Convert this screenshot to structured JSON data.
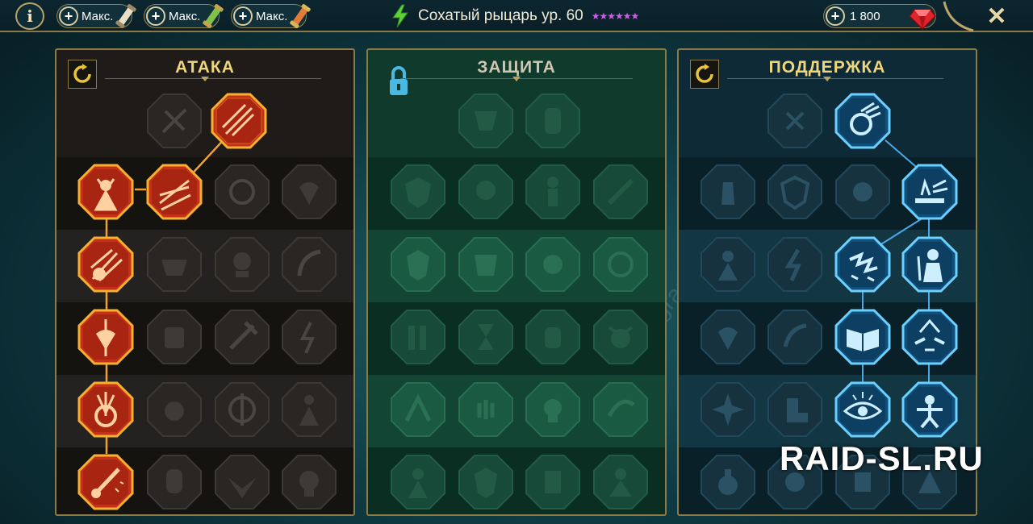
{
  "topbar": {
    "info_label": "i",
    "max_buttons": [
      {
        "label": "Макс."
      },
      {
        "label": "Макс."
      },
      {
        "label": "Макс."
      }
    ],
    "hero_name": "Сохатый рыцарь ур. 60",
    "stars": "★★★★★★",
    "gems_value": "1 800",
    "close_label": "✕"
  },
  "panels": [
    {
      "title": "АТАКА"
    },
    {
      "title": "ЗАЩИТА"
    },
    {
      "title": "ПОДДЕРЖКА"
    }
  ],
  "watermark": "RAID-SL.RU",
  "colors": {
    "attack_active": "#f08a2a",
    "support_active": "#3ab8f0",
    "frame_gold": "#8c7a47"
  }
}
